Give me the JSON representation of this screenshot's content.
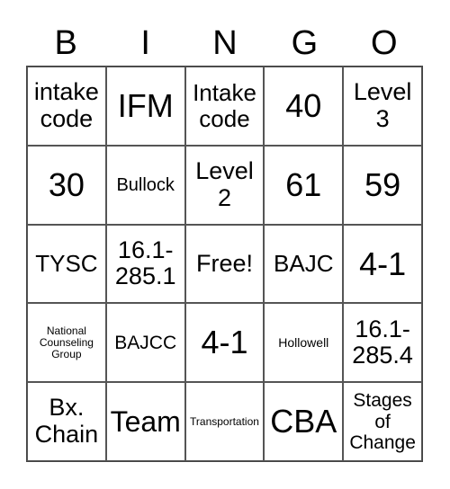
{
  "card": {
    "header": [
      "B",
      "I",
      "N",
      "G",
      "O"
    ],
    "rows": [
      [
        "intake code",
        "IFM",
        "Intake code",
        "40",
        "Level 3"
      ],
      [
        "30",
        "Bullock",
        "Level 2",
        "61",
        "59"
      ],
      [
        "TYSC",
        "16.1-285.1",
        "Free!",
        "BAJC",
        "4-1"
      ],
      [
        "National Counseling Group",
        "BAJCC",
        "4-1",
        "Hollowell",
        "16.1-285.4"
      ],
      [
        "Bx. Chain",
        "Team",
        "Transportation",
        "CBA",
        "Stages of Change"
      ]
    ]
  }
}
